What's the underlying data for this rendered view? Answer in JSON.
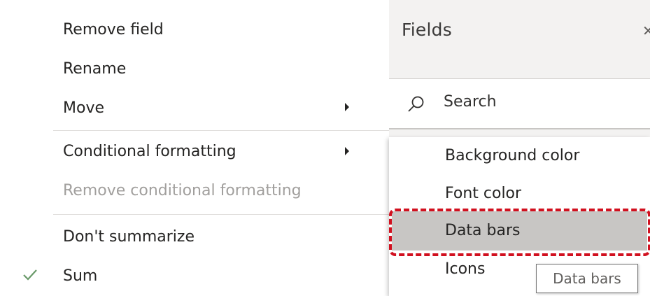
{
  "context_menu": {
    "items": [
      {
        "label": "Remove field"
      },
      {
        "label": "Rename"
      },
      {
        "label": "Move"
      },
      {
        "label": "Conditional formatting"
      },
      {
        "label": "Remove conditional formatting"
      },
      {
        "label": "Don't summarize"
      },
      {
        "label": "Sum",
        "checked": true
      }
    ]
  },
  "fields_pane": {
    "title": "Fields",
    "search_placeholder": "Search"
  },
  "conditional_formatting_submenu": {
    "items": [
      {
        "label": "Background color"
      },
      {
        "label": "Font color"
      },
      {
        "label": "Data bars",
        "highlighted": true
      },
      {
        "label": "Icons"
      }
    ]
  },
  "tooltip": {
    "text": "Data bars"
  },
  "colors": {
    "highlight_outline": "#d1101f",
    "hover_background": "#c8c6c4",
    "check_color": "#107c10"
  },
  "icons": {
    "search": "search-icon",
    "submenu_arrow": "chevron-right-icon",
    "check": "check-icon"
  }
}
